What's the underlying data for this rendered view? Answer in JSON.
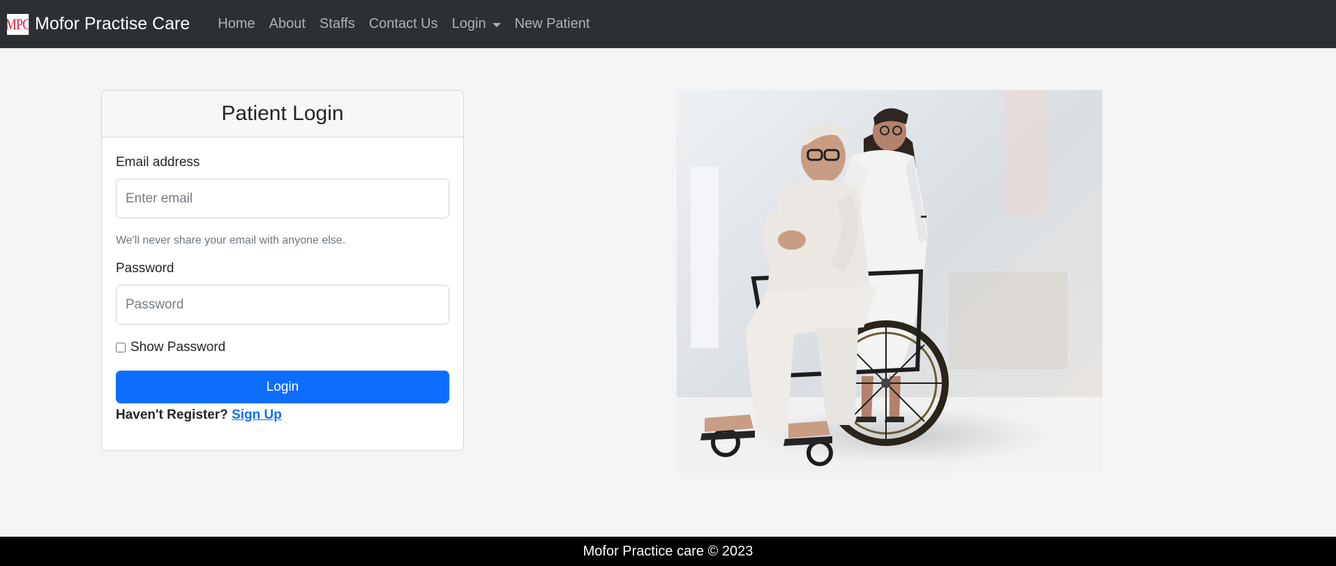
{
  "navbar": {
    "logo_text": "MPC",
    "brand": "Mofor Practise Care",
    "links": [
      "Home",
      "About",
      "Staffs",
      "Contact Us"
    ],
    "login_dropdown": "Login",
    "new_patient": "New Patient"
  },
  "login": {
    "title": "Patient Login",
    "email_label": "Email address",
    "email_placeholder": "Enter email",
    "email_help": "We'll never share your email with anyone else.",
    "password_label": "Password",
    "password_placeholder": "Password",
    "show_password": "Show Password",
    "submit": "Login",
    "register_prompt": "Haven't Register?",
    "signup": "Sign Up"
  },
  "footer": {
    "text": "Mofor Practice care © 2023"
  },
  "colors": {
    "navbar": "#2b3035",
    "primary": "#0d6efd",
    "logo_red": "#d6223a",
    "footer": "#000000",
    "page_bg": "#f4f4f4"
  }
}
